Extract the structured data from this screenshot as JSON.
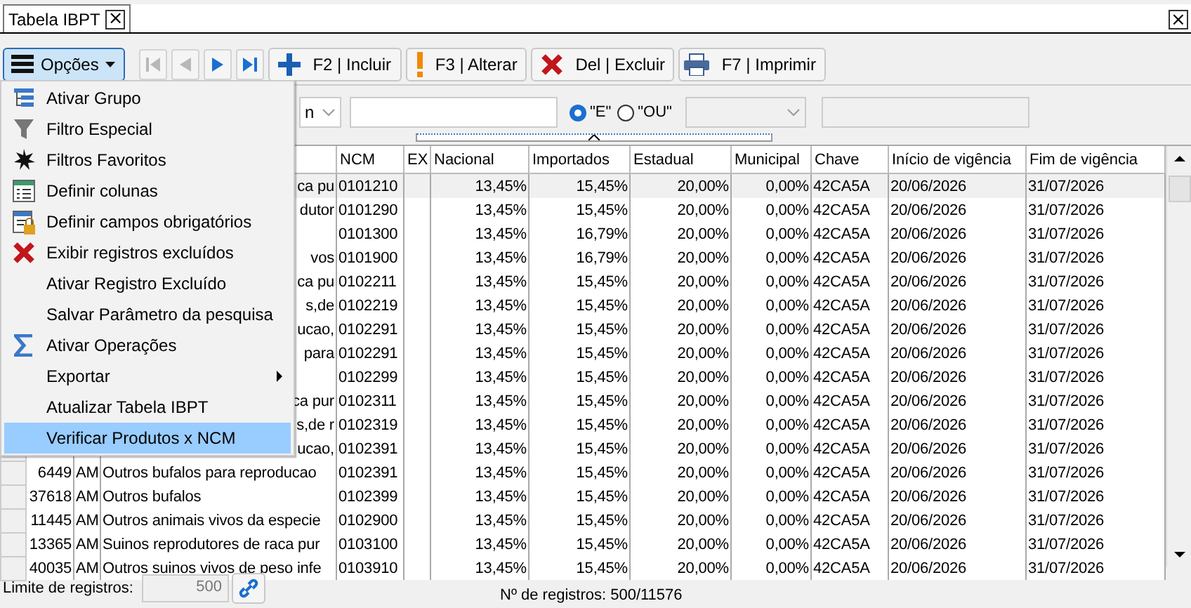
{
  "tab": {
    "title": "Tabela IBPT",
    "close": "×"
  },
  "window_close": "×",
  "toolbar": {
    "options_button": {
      "label": "Opções",
      "pressed": true
    },
    "nav": [
      {
        "kind": "first",
        "disabled": true
      },
      {
        "kind": "prev",
        "disabled": true
      },
      {
        "kind": "next",
        "disabled": false
      },
      {
        "kind": "last",
        "disabled": false
      }
    ],
    "buttons": [
      {
        "kind": "add",
        "label": "F2 | Incluir"
      },
      {
        "kind": "edit",
        "label": "F3 | Alterar"
      },
      {
        "kind": "delete",
        "label": "Del | Excluir"
      },
      {
        "kind": "print",
        "label": "F7 | Imprimir"
      }
    ]
  },
  "filter": {
    "field_combo_text": "n",
    "radios": [
      {
        "label": "\"E\"",
        "selected": true
      },
      {
        "label": "\"OU\"",
        "selected": false
      }
    ]
  },
  "menu": [
    {
      "kind": "tree",
      "label": "Ativar Grupo",
      "selected": false
    },
    {
      "kind": "funnel",
      "label": "Filtro Especial",
      "selected": false
    },
    {
      "kind": "burst",
      "label": "Filtros Favoritos",
      "selected": false
    },
    {
      "kind": "columns",
      "label": "Definir colunas",
      "selected": false
    },
    {
      "kind": "lock",
      "label": "Definir campos obrigatórios",
      "selected": false
    },
    {
      "kind": "delete",
      "label": "Exibir registros excluídos",
      "selected": false
    },
    {
      "kind": "none",
      "label": "Ativar Registro Excluído",
      "selected": false
    },
    {
      "kind": "none",
      "label": "Salvar Parâmetro da pesquisa",
      "selected": false
    },
    {
      "kind": "sigma",
      "label": "Ativar Operações",
      "selected": false
    },
    {
      "kind": "submenu",
      "label": "Exportar",
      "selected": false
    },
    {
      "kind": "none",
      "label": "Atualizar Tabela IBPT",
      "selected": false
    },
    {
      "kind": "none",
      "label": "Verificar Produtos x NCM",
      "selected": true
    }
  ],
  "table": {
    "columns": [
      "NCM",
      "EX",
      "Nacional",
      "Importados",
      "Estadual",
      "Municipal",
      "Chave",
      "Início de vigência",
      "Fim de vigência"
    ],
    "rows": [
      {
        "selected": true,
        "description": "ca pu",
        "ncm": "0101210",
        "nacional": "13,45%",
        "importados": "15,45%",
        "estadual": "20,00%",
        "municipal": "0,00%",
        "chave": "42CA5A",
        "inicio": "20/06/2026",
        "fim": "31/07/2026"
      },
      {
        "selected": false,
        "description": "dutor",
        "ncm": "0101290",
        "nacional": "13,45%",
        "importados": "15,45%",
        "estadual": "20,00%",
        "municipal": "0,00%",
        "chave": "42CA5A",
        "inicio": "20/06/2026",
        "fim": "31/07/2026"
      },
      {
        "selected": false,
        "ncm": "0101300",
        "nacional": "13,45%",
        "importados": "16,79%",
        "estadual": "20,00%",
        "municipal": "0,00%",
        "chave": "42CA5A",
        "inicio": "20/06/2026",
        "fim": "31/07/2026"
      },
      {
        "selected": false,
        "description": "vos",
        "ncm": "0101900",
        "nacional": "13,45%",
        "importados": "16,79%",
        "estadual": "20,00%",
        "municipal": "0,00%",
        "chave": "42CA5A",
        "inicio": "20/06/2026",
        "fim": "31/07/2026"
      },
      {
        "selected": false,
        "description": "ca pu",
        "ncm": "0102211",
        "nacional": "13,45%",
        "importados": "15,45%",
        "estadual": "20,00%",
        "municipal": "0,00%",
        "chave": "42CA5A",
        "inicio": "20/06/2026",
        "fim": "31/07/2026"
      },
      {
        "selected": false,
        "description": "s,de",
        "ncm": "0102219",
        "nacional": "13,45%",
        "importados": "15,45%",
        "estadual": "20,00%",
        "municipal": "0,00%",
        "chave": "42CA5A",
        "inicio": "20/06/2026",
        "fim": "31/07/2026"
      },
      {
        "selected": false,
        "description": "ucao,",
        "ncm": "0102291",
        "nacional": "13,45%",
        "importados": "15,45%",
        "estadual": "20,00%",
        "municipal": "0,00%",
        "chave": "42CA5A",
        "inicio": "20/06/2026",
        "fim": "31/07/2026"
      },
      {
        "selected": false,
        "description": "para",
        "ncm": "0102291",
        "nacional": "13,45%",
        "importados": "15,45%",
        "estadual": "20,00%",
        "municipal": "0,00%",
        "chave": "42CA5A",
        "inicio": "20/06/2026",
        "fim": "31/07/2026"
      },
      {
        "selected": false,
        "ncm": "0102299",
        "nacional": "13,45%",
        "importados": "15,45%",
        "estadual": "20,00%",
        "municipal": "0,00%",
        "chave": "42CA5A",
        "inicio": "20/06/2026",
        "fim": "31/07/2026"
      },
      {
        "selected": false,
        "description": "ca pur",
        "ncm": "0102311",
        "nacional": "13,45%",
        "importados": "15,45%",
        "estadual": "20,00%",
        "municipal": "0,00%",
        "chave": "42CA5A",
        "inicio": "20/06/2026",
        "fim": "31/07/2026"
      },
      {
        "selected": false,
        "description": "s,de r",
        "ncm": "0102319",
        "nacional": "13,45%",
        "importados": "15,45%",
        "estadual": "20,00%",
        "municipal": "0,00%",
        "chave": "42CA5A",
        "inicio": "20/06/2026",
        "fim": "31/07/2026"
      },
      {
        "selected": false,
        "description": "ucao,",
        "ncm": "0102391",
        "nacional": "13,45%",
        "importados": "15,45%",
        "estadual": "20,00%",
        "municipal": "0,00%",
        "chave": "42CA5A",
        "inicio": "20/06/2026",
        "fim": "31/07/2026"
      },
      {
        "selected": false,
        "id": "6449",
        "uf": "AM",
        "description": "Outros bufalos para reproducao",
        "ncm": "0102391",
        "nacional": "13,45%",
        "importados": "15,45%",
        "estadual": "20,00%",
        "municipal": "0,00%",
        "chave": "42CA5A",
        "inicio": "20/06/2026",
        "fim": "31/07/2026"
      },
      {
        "selected": false,
        "id": "37618",
        "uf": "AM",
        "description": "Outros bufalos",
        "ncm": "0102399",
        "nacional": "13,45%",
        "importados": "15,45%",
        "estadual": "20,00%",
        "municipal": "0,00%",
        "chave": "42CA5A",
        "inicio": "20/06/2026",
        "fim": "31/07/2026"
      },
      {
        "selected": false,
        "id": "11445",
        "uf": "AM",
        "description": "Outros animais vivos da especie",
        "ncm": "0102900",
        "nacional": "13,45%",
        "importados": "15,45%",
        "estadual": "20,00%",
        "municipal": "0,00%",
        "chave": "42CA5A",
        "inicio": "20/06/2026",
        "fim": "31/07/2026"
      },
      {
        "selected": false,
        "id": "13365",
        "uf": "AM",
        "description": "Suinos reprodutores de raca pur",
        "ncm": "0103100",
        "nacional": "13,45%",
        "importados": "15,45%",
        "estadual": "20,00%",
        "municipal": "0,00%",
        "chave": "42CA5A",
        "inicio": "20/06/2026",
        "fim": "31/07/2026"
      },
      {
        "selected": false,
        "id": "40035",
        "uf": "AM",
        "description": "Outros suinos vivos de peso infe",
        "ncm": "0103910",
        "nacional": "13,45%",
        "importados": "15,45%",
        "estadual": "20,00%",
        "municipal": "0,00%",
        "chave": "42CA5A",
        "inicio": "20/06/2026",
        "fim": "31/07/2026"
      }
    ]
  },
  "footer": {
    "limit_label": "Limite de registros:",
    "limit_value": "500",
    "count": "Nº de registros: 500/11576"
  }
}
